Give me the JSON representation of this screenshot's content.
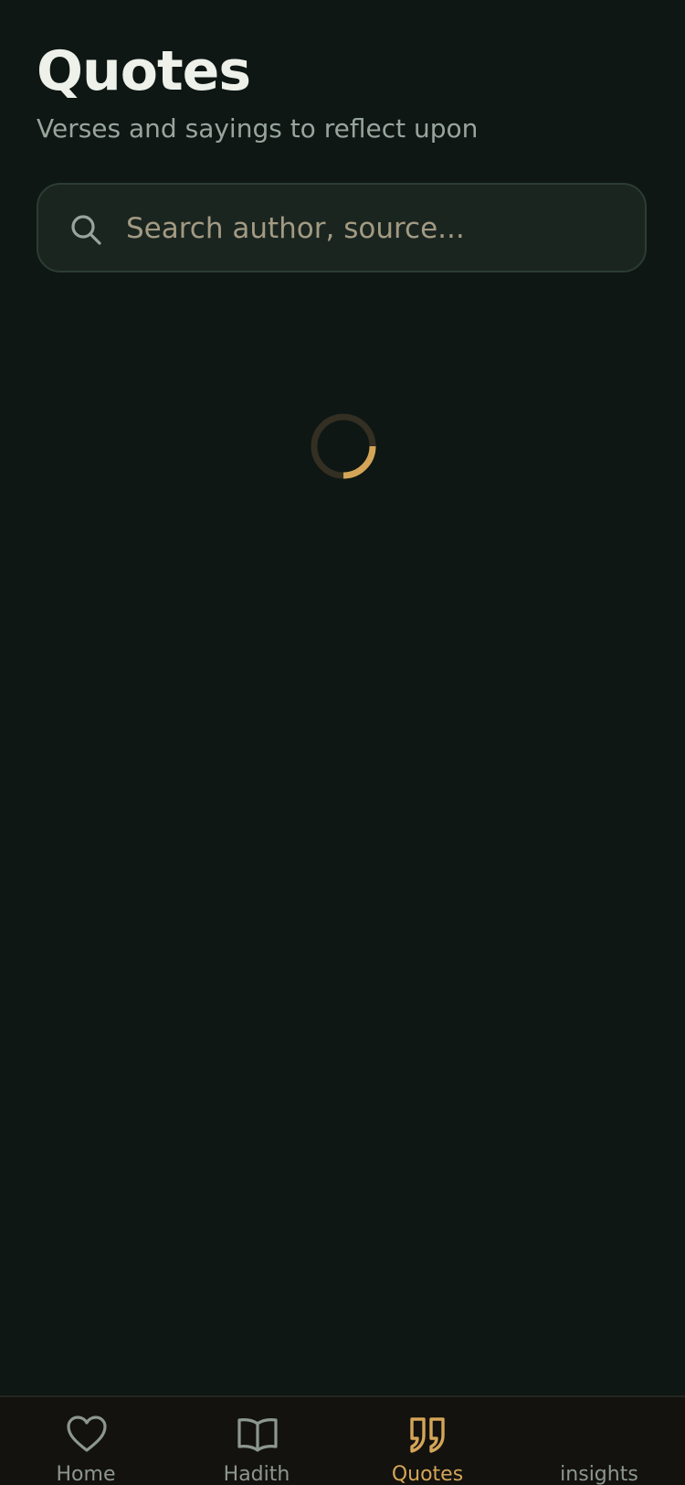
{
  "header": {
    "title": "Quotes",
    "subtitle": "Verses and sayings to reflect upon"
  },
  "search": {
    "placeholder": "Search author, source...",
    "value": "",
    "icon": "search-icon"
  },
  "loading": {
    "icon": "loading-spinner-icon",
    "progress": 0.25
  },
  "colors": {
    "background": "#0e1714",
    "accent": "#d4a557",
    "text_primary": "#edf1ea",
    "text_secondary": "#98a59d",
    "search_bg": "#1a2520",
    "tabbar_bg": "#13120f",
    "inactive_icon": "#8c978f"
  },
  "tabbar": {
    "active": "Quotes",
    "items": [
      {
        "label": "Home",
        "icon": "heart-icon"
      },
      {
        "label": "Hadith",
        "icon": "open-book-icon"
      },
      {
        "label": "Quotes",
        "icon": "quote-icon"
      },
      {
        "label": "insights",
        "icon": ""
      }
    ]
  }
}
